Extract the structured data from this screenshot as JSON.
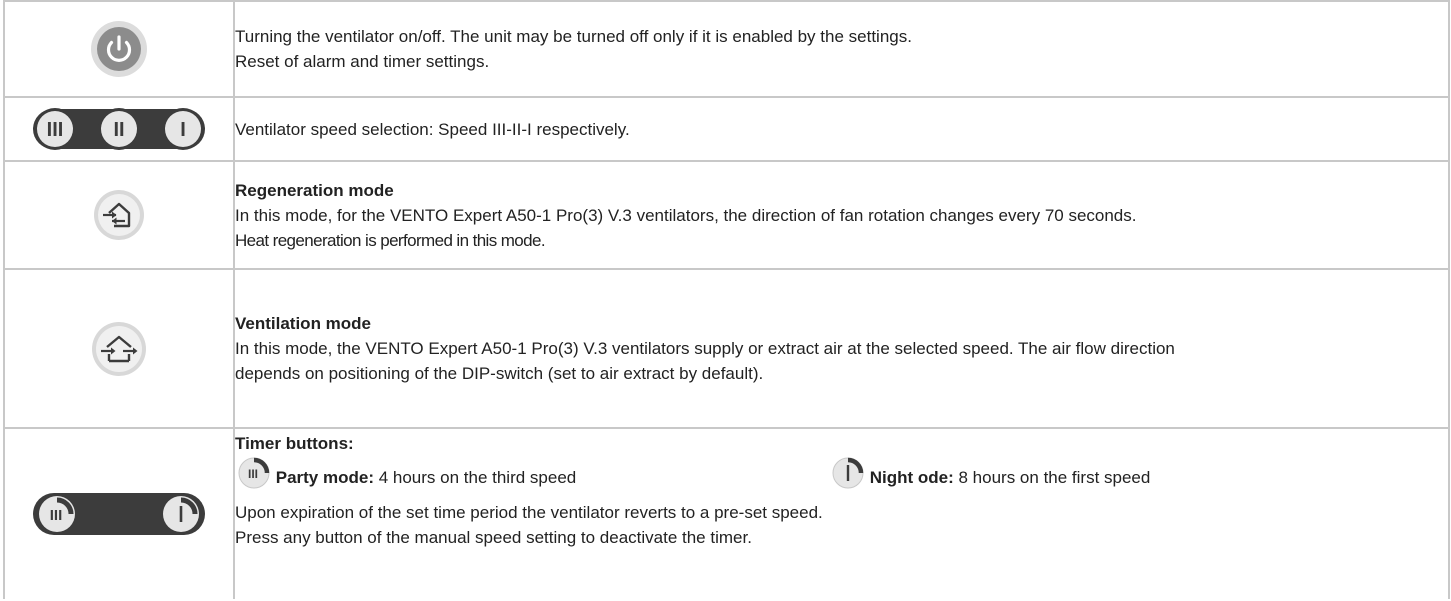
{
  "rows": [
    {
      "icon": "power-button-icon",
      "lines": [
        "Turning the ventilator on/off. The unit may be turned off only if it is enabled by the settings.",
        "Reset of alarm and timer settings."
      ]
    },
    {
      "icon": "speed-selection-buttons-icon",
      "speed_labels": [
        "III",
        "II",
        "I"
      ],
      "lines": [
        "Ventilator speed selection: Speed III-II-I respectively."
      ]
    },
    {
      "icon": "regeneration-mode-icon",
      "heading": "Regeneration mode",
      "lines": [
        "In this mode, for the VENTO Expert A50-1 Pro(3) V.3 ventilators, the direction of fan rotation changes every 70 seconds.",
        "Heat regeneration is performed in this mode."
      ]
    },
    {
      "icon": "ventilation-mode-icon",
      "heading": "Ventilation mode",
      "lines": [
        "In this mode, the VENTO Expert A50-1 Pro(3) V.3 ventilators supply or extract air at the selected speed. The air flow direction",
        "depends on positioning of the DIP-switch (set to air extract by default)."
      ]
    },
    {
      "icon": "timer-buttons-icon",
      "heading": "Timer buttons:",
      "party_label": "Party mode:",
      "party_text": " 4 hours on the third speed",
      "night_label": "Night ode:",
      "night_text": " 8 hours on the first speed",
      "lines": [
        "Upon expiration of the set time period the ventilator reverts to a pre-set speed.",
        "Press any button of the manual speed setting to deactivate the timer."
      ]
    }
  ],
  "colors": {
    "border": "#c8c8c8",
    "button_dark": "#3c3c3c",
    "button_light": "#e6e6e6",
    "power_gray": "#8c8c8c"
  }
}
